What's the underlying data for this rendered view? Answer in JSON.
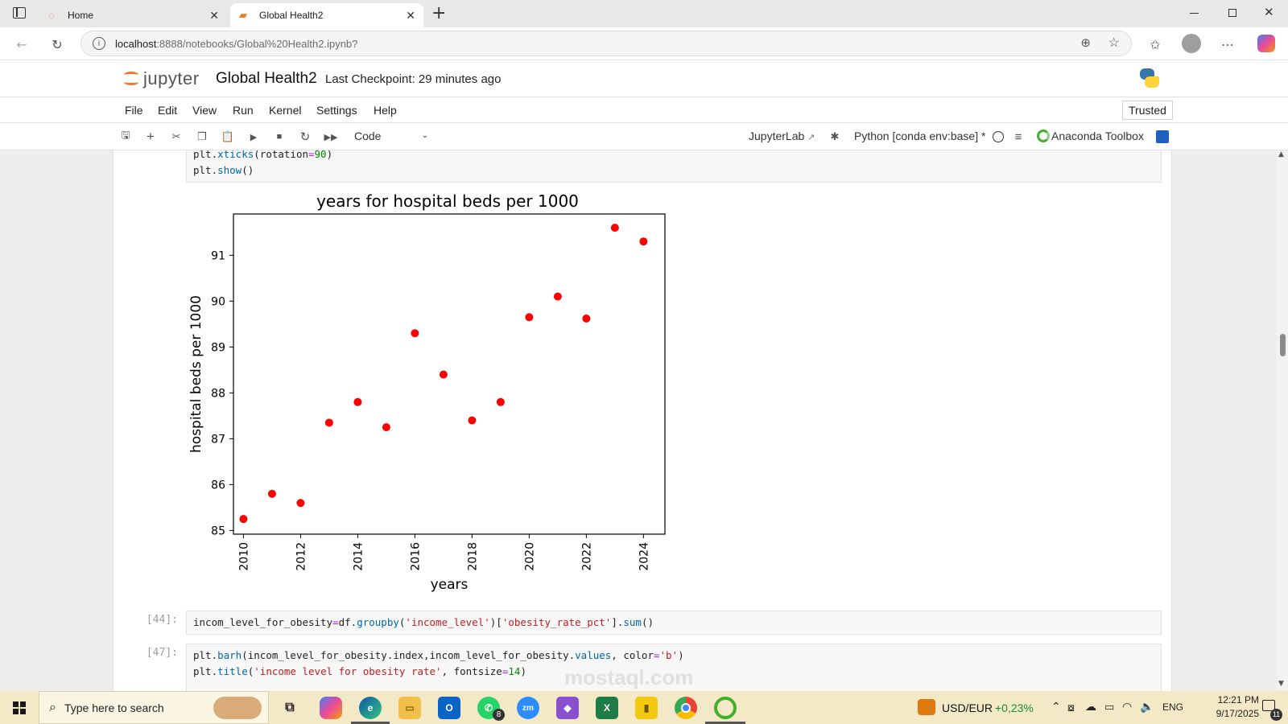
{
  "browser": {
    "tabs": [
      {
        "label": "Home",
        "active": false
      },
      {
        "label": "Global Health2",
        "active": true
      }
    ],
    "url_host": "localhost",
    "url_path": ":8888/notebooks/Global%20Health2.ipynb?"
  },
  "jupyter": {
    "logo_text": "jupyter",
    "notebook_title": "Global Health2",
    "checkpoint": "Last Checkpoint: 29 minutes ago",
    "trusted_label": "Trusted"
  },
  "menu": {
    "items": [
      "File",
      "Edit",
      "View",
      "Run",
      "Kernel",
      "Settings",
      "Help"
    ]
  },
  "toolbar": {
    "cell_type": "Code",
    "jupyterlab_label": "JupyterLab",
    "kernel_label": "Python [conda env:base] *",
    "anaconda_label": "Anaconda Toolbox"
  },
  "cells": {
    "top_line1_a": "plt.",
    "top_line1_b": "xticks",
    "top_line1_c": "(rotation",
    "top_line1_d": "=",
    "top_line1_e": "90",
    "top_line1_f": ")",
    "top_line2_a": "plt.",
    "top_line2_b": "show",
    "top_line2_c": "()",
    "cell44_prompt": "[44]:",
    "cell44_a": "incom_level_for_obesity",
    "cell44_b": "=",
    "cell44_c": "df.",
    "cell44_d": "groupby",
    "cell44_e": "(",
    "cell44_f": "'income_level'",
    "cell44_g": ")[",
    "cell44_h": "'obesity_rate_pct'",
    "cell44_i": "].",
    "cell44_j": "sum",
    "cell44_k": "()",
    "cell47_prompt": "[47]:",
    "cell47_l1_a": "plt.",
    "cell47_l1_b": "barh",
    "cell47_l1_c": "(incom_level_for_obesity.index,incom_level_for_obesity.",
    "cell47_l1_d": "values",
    "cell47_l1_e": ", color",
    "cell47_l1_f": "=",
    "cell47_l1_g": "'b'",
    "cell47_l1_h": ")",
    "cell47_l2_a": "plt.",
    "cell47_l2_b": "title",
    "cell47_l2_c": "(",
    "cell47_l2_d": "'income level for obesity rate'",
    "cell47_l2_e": ", fontsize",
    "cell47_l2_f": "=",
    "cell47_l2_g": "14",
    "cell47_l2_h": ")"
  },
  "chart_data": {
    "type": "scatter",
    "title": "years for hospital beds per 1000",
    "xlabel": "years",
    "ylabel": "hospital beds per 1000",
    "x": [
      2010,
      2011,
      2012,
      2013,
      2014,
      2015,
      2016,
      2017,
      2018,
      2019,
      2020,
      2021,
      2022,
      2023,
      2024
    ],
    "y": [
      85.25,
      85.8,
      85.6,
      87.35,
      87.8,
      87.25,
      89.3,
      88.4,
      87.4,
      87.8,
      89.65,
      90.1,
      89.62,
      91.6,
      91.3
    ],
    "xlim": [
      2009.65,
      2024.75
    ],
    "ylim": [
      84.92,
      91.9
    ],
    "xticks": [
      2010,
      2012,
      2014,
      2016,
      2018,
      2020,
      2022,
      2024
    ],
    "yticks": [
      85,
      86,
      87,
      88,
      89,
      90,
      91
    ],
    "marker_color": "#ff0000",
    "xtick_rotation": 90,
    "grid": false
  },
  "taskbar": {
    "search_placeholder": "Type here to search",
    "currency": "USD/EUR",
    "currency_change": "+0,23%",
    "language": "ENG",
    "time": "12:21 PM",
    "date": "9/17/2025",
    "whatsapp_badge": "8",
    "notification_count": "11"
  },
  "watermark_text": "mostaql.com",
  "colors": {
    "jupyter_orange": "#f37726",
    "taskbar_bg": "#f3e9c6",
    "currency_change_color": "#1a8a3a"
  }
}
